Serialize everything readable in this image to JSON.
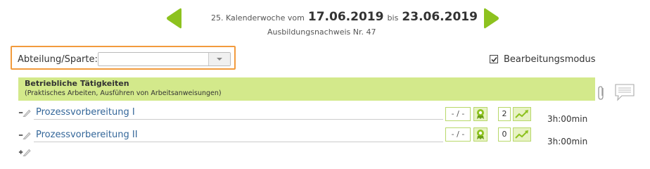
{
  "week": {
    "prefix": "25. Kalenderwoche vom",
    "start": "17.06.2019",
    "between": "bis",
    "end": "23.06.2019",
    "report": "Ausbildungsnachweis Nr. 47"
  },
  "department": {
    "label": "Abteilung/Sparte:",
    "value": ""
  },
  "edit_mode": {
    "label": "Bearbeitungsmodus",
    "checked": true
  },
  "activity": {
    "title": "Betriebliche Tätigkeiten",
    "subtitle": "(Praktisches Arbeiten, Ausführen von Arbeitsanweisungen)"
  },
  "rows": [
    {
      "title": "Prozessvorbereitung I",
      "grade": "- / -",
      "count": "2",
      "duration": "3h:00min"
    },
    {
      "title": "Prozessvorbereitung II",
      "grade": "- / -",
      "count": "0",
      "duration": "3h:00min"
    }
  ],
  "colors": {
    "accent_green": "#8dc21f",
    "banner_green": "#d3e98b",
    "highlight_orange": "#f29b3d",
    "link_blue": "#336699"
  }
}
